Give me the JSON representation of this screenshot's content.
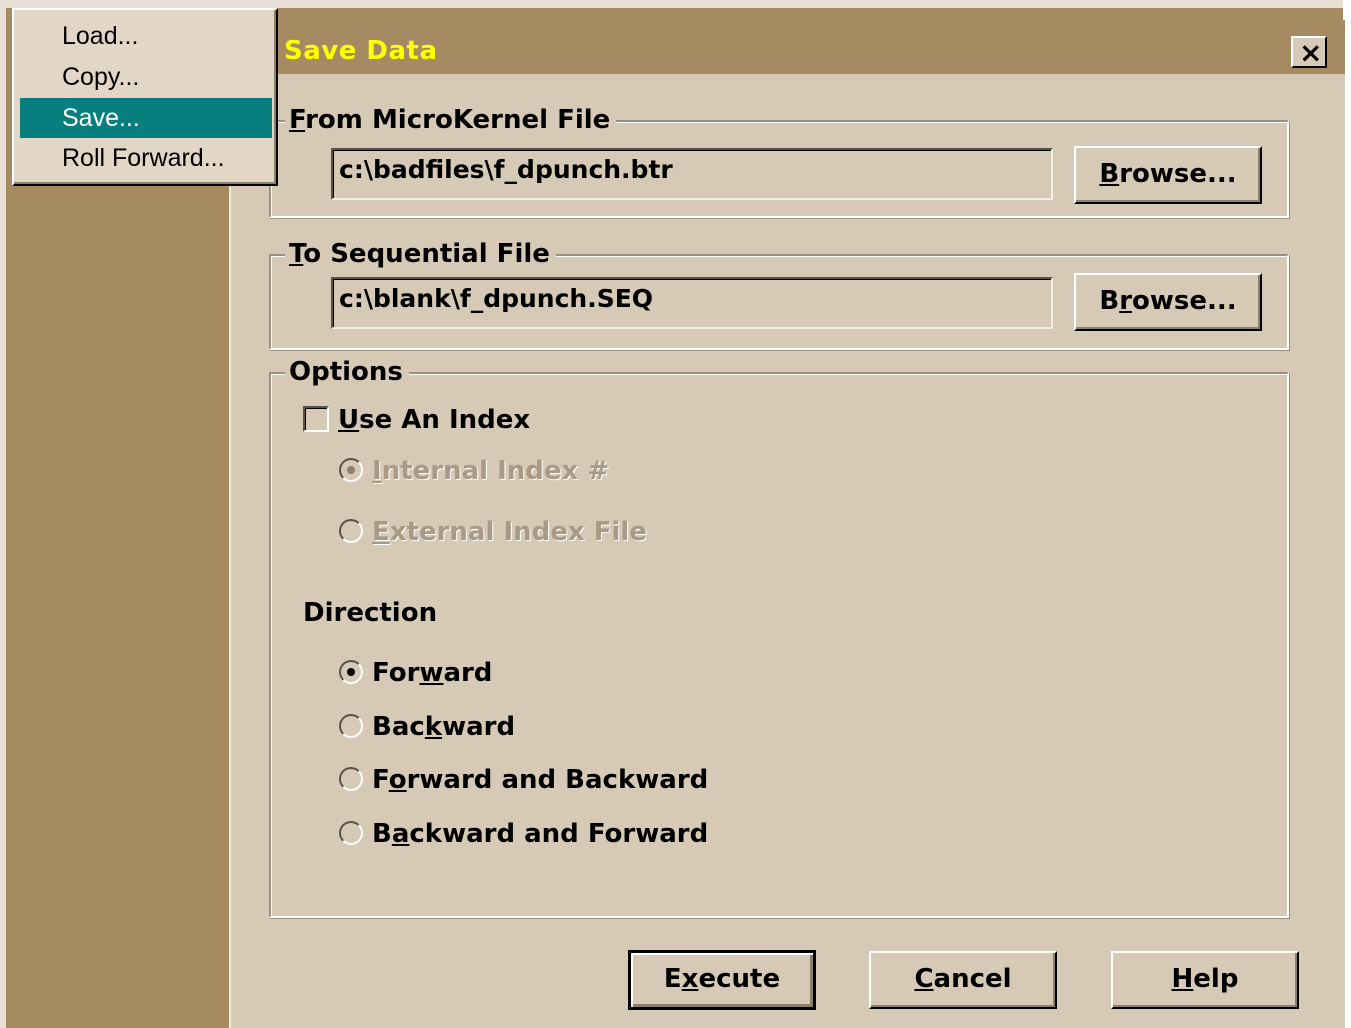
{
  "menu": {
    "items": [
      {
        "label": "Load..."
      },
      {
        "label": "Copy..."
      },
      {
        "label": "Save...",
        "selected": true
      },
      {
        "label": "Roll Forward..."
      }
    ],
    "highlight_color": "#087f7f"
  },
  "dialog": {
    "title": "Save Data",
    "title_color": "#ffff00",
    "close_glyph": "×",
    "from_group": {
      "legend_first": "F",
      "legend_rest": "rom MicroKernel File",
      "path": "c:\\badfiles\\f_dpunch.btr",
      "browse_first": "B",
      "browse_rest": "rowse..."
    },
    "to_group": {
      "legend_first": "T",
      "legend_rest": "o Sequential File",
      "path": "c:\\blank\\f_dpunch.SEQ",
      "browse_a": "B",
      "browse_u": "r",
      "browse_b": "owse..."
    },
    "options": {
      "legend": "Options",
      "use_index": {
        "first": "U",
        "rest": "se An Index",
        "checked": false
      },
      "internal_index": {
        "first": "I",
        "rest": "nternal Index #",
        "selected": true,
        "enabled": false
      },
      "external_index": {
        "first": "E",
        "rest": "xternal Index File",
        "selected": false,
        "enabled": false
      },
      "direction_label": "Direction",
      "directions": [
        {
          "a": "For",
          "u": "w",
          "b": "ard",
          "selected": true
        },
        {
          "a": "Bac",
          "u": "k",
          "b": "ward",
          "selected": false
        },
        {
          "a": "F",
          "u": "o",
          "b": "rward and Backward",
          "selected": false
        },
        {
          "a": "B",
          "u": "a",
          "b": "ckward and Forward",
          "selected": false
        }
      ]
    },
    "buttons": {
      "execute": {
        "a": "E",
        "u": "x",
        "b": "ecute"
      },
      "cancel": {
        "u": "C",
        "b": "ancel"
      },
      "help": {
        "u": "H",
        "b": "elp"
      }
    }
  }
}
